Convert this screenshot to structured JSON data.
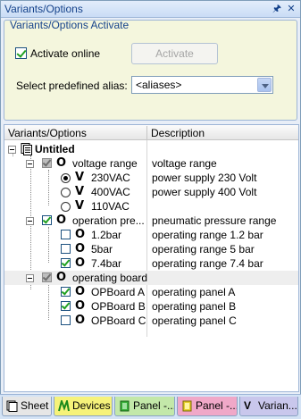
{
  "window": {
    "title": "Variants/Options",
    "pin_icon": "pin-icon",
    "close_icon": "close-icon"
  },
  "activate_group": {
    "legend": "Variants/Options Activate",
    "activate_online_label": "Activate online",
    "activate_online_checked": true,
    "activate_button_label": "Activate",
    "alias_label": "Select predefined alias:",
    "alias_value": "<aliases>"
  },
  "grid": {
    "columns": [
      "Variants/Options",
      "Description"
    ],
    "rows": [
      {
        "label": "Untitled",
        "desc": "",
        "kind": "root"
      },
      {
        "label": "voltage range",
        "desc": "voltage range"
      },
      {
        "label": "230VAC",
        "desc": "power supply 230 Volt"
      },
      {
        "label": "400VAC",
        "desc": "power supply 400 Volt"
      },
      {
        "label": "110VAC",
        "desc": ""
      },
      {
        "label": "operation pre...",
        "desc": "pneumatic pressure range"
      },
      {
        "label": "1.2bar",
        "desc": "operating range 1.2 bar"
      },
      {
        "label": "5bar",
        "desc": "operating range 5 bar"
      },
      {
        "label": "7.4bar",
        "desc": "operating range 7.4 bar"
      },
      {
        "label": "operating board",
        "desc": ""
      },
      {
        "label": "OPBoard A",
        "desc": "operating panel A"
      },
      {
        "label": "OPBoard B",
        "desc": "operating panel B"
      },
      {
        "label": "OPBoard C",
        "desc": "operating panel C"
      }
    ]
  },
  "tabs": [
    {
      "label": "Sheet",
      "icon": "sheet-icon",
      "color": "#e6e6e6"
    },
    {
      "label": "Devices",
      "icon": "devices-icon",
      "color": "#f6f27a"
    },
    {
      "label": "Panel -...",
      "icon": "panel-icon",
      "color": "#c3e8a9"
    },
    {
      "label": "Panel -...",
      "icon": "panel-icon",
      "color": "#f0a8c8"
    },
    {
      "label": "Varian...",
      "icon": "variants-icon",
      "color": "#c9c7ec"
    }
  ]
}
